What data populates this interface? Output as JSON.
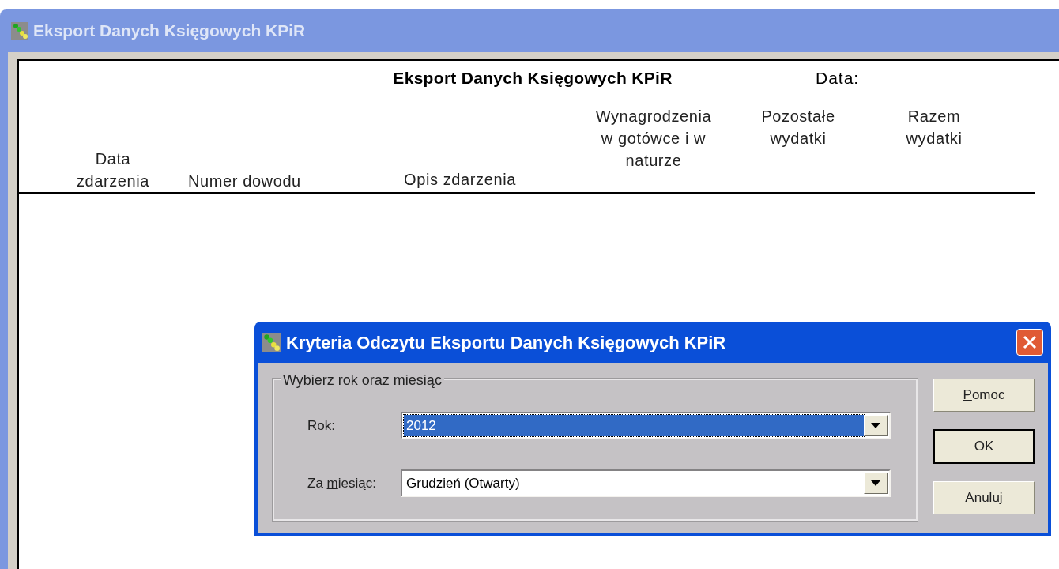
{
  "window": {
    "title": "Eksport Danych Księgowych KPiR"
  },
  "report": {
    "title": "Eksport Danych Księgowych KPiR",
    "date_label": "Data:",
    "columns": [
      "Data zdarzenia",
      "Numer dowodu",
      "Opis zdarzenia",
      "Wynagrodzenia w gotówce i w naturze",
      "Pozostałe wydatki",
      "Razem wydatki"
    ]
  },
  "dialog": {
    "title": "Kryteria Odczytu Eksportu Danych Księgowych KPiR",
    "group_label": "Wybierz rok oraz miesiąc",
    "fields": [
      {
        "label": [
          {
            "text": "R",
            "underlined": true
          },
          {
            "text": "ok:",
            "underlined": false
          }
        ],
        "value": "2012",
        "focused": true
      },
      {
        "label": [
          {
            "text": "Za ",
            "underlined": false
          },
          {
            "text": "m",
            "underlined": true
          },
          {
            "text": "iesiąc:",
            "underlined": false
          }
        ],
        "value": "Grudzień  (Otwarty)",
        "focused": false
      }
    ],
    "buttons": [
      {
        "label": [
          {
            "text": "P",
            "underlined": true
          },
          {
            "text": "omoc",
            "underlined": false
          }
        ],
        "default": false
      },
      {
        "label": [
          {
            "text": "OK",
            "underlined": false
          }
        ],
        "default": true
      },
      {
        "label": [
          {
            "text": "Anuluj",
            "underlined": false
          }
        ],
        "default": false
      }
    ]
  }
}
